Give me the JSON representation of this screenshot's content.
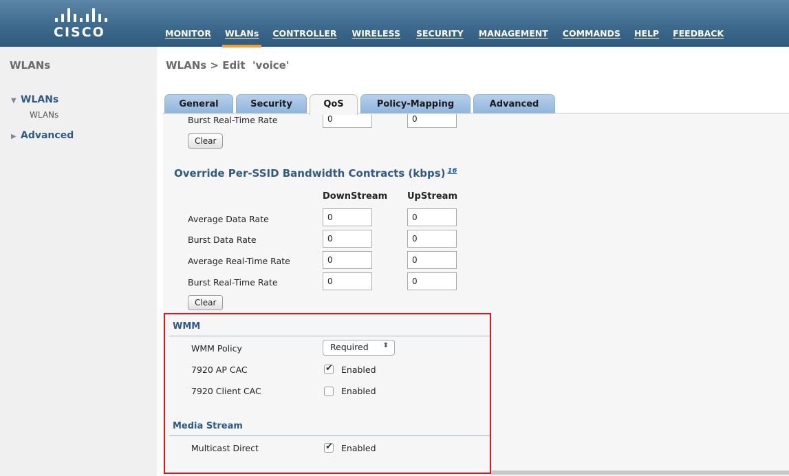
{
  "header": {
    "logo_text": "CISCO",
    "nav": [
      "MONITOR",
      "WLANs",
      "CONTROLLER",
      "WIRELESS",
      "SECURITY",
      "MANAGEMENT",
      "COMMANDS",
      "HELP",
      "FEEDBACK"
    ],
    "active_nav": "WLANs"
  },
  "sidebar": {
    "title": "WLANs",
    "groups": [
      {
        "label": "WLANs",
        "expanded": true,
        "items": [
          "WLANs"
        ]
      },
      {
        "label": "Advanced",
        "expanded": false
      }
    ]
  },
  "page": {
    "title": "WLANs > Edit  'voice'"
  },
  "tabs": [
    "General",
    "Security",
    "QoS",
    "Policy-Mapping",
    "Advanced"
  ],
  "active_tab": "QoS",
  "top_partial": {
    "label": "Burst Real-Time Rate",
    "downstream": "0",
    "upstream": "0",
    "clear_label": "Clear"
  },
  "bandwidth": {
    "title": "Override Per-SSID Bandwidth Contracts (kbps)",
    "footnote": "16",
    "col_downstream": "DownStream",
    "col_upstream": "UpStream",
    "rows": [
      {
        "label": "Average Data Rate",
        "down": "0",
        "up": "0"
      },
      {
        "label": "Burst Data Rate",
        "down": "0",
        "up": "0"
      },
      {
        "label": "Average Real-Time Rate",
        "down": "0",
        "up": "0"
      },
      {
        "label": "Burst Real-Time Rate",
        "down": "0",
        "up": "0"
      }
    ],
    "clear_label": "Clear"
  },
  "wmm": {
    "title": "WMM",
    "policy_label": "WMM Policy",
    "policy_value": "Required",
    "ap_cac_label": "7920 AP CAC",
    "ap_cac_checked": true,
    "ap_cac_option": "Enabled",
    "client_cac_label": "7920 Client CAC",
    "client_cac_checked": false,
    "client_cac_option": "Enabled"
  },
  "media_stream": {
    "title": "Media Stream",
    "multicast_label": "Multicast Direct",
    "multicast_checked": true,
    "multicast_option": "Enabled"
  },
  "colors": {
    "header_top": "#5b86a6",
    "header_bottom": "#2f5a7e",
    "active_nav_bar": "#f0a030",
    "section_title": "#2e5a85",
    "highlight_border": "#e0141c"
  }
}
